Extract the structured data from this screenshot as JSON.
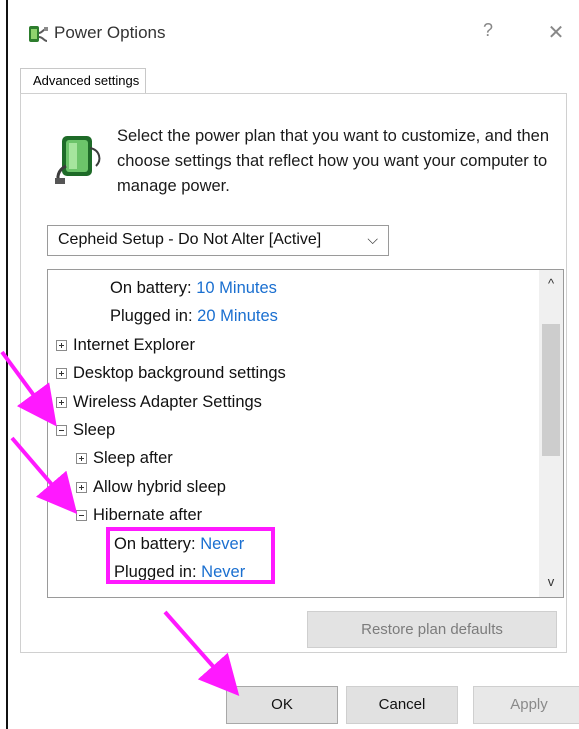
{
  "window": {
    "title": "Power Options",
    "help_symbol": "?",
    "close_symbol": "✕",
    "title_icon": "power-plan-icon"
  },
  "tabs": [
    {
      "label": "Advanced settings",
      "active": true
    }
  ],
  "intro": {
    "icon": "battery-plug-icon",
    "text": "Select the power plan that you want to customize, and then choose settings that reflect how you want your computer to manage power."
  },
  "plan_select": {
    "value": "Cepheid Setup - Do Not Alter [Active]",
    "chevron": "⌵"
  },
  "tree": {
    "rows": [
      {
        "name": "on-battery-setting",
        "type": "setting",
        "label": "On battery:",
        "value": "10 Minutes"
      },
      {
        "name": "plugged-in-setting",
        "type": "setting",
        "label": "Plugged in:",
        "value": "20 Minutes"
      },
      {
        "name": "internet-explorer",
        "type": "node",
        "state": "plus",
        "label": "Internet Explorer"
      },
      {
        "name": "desktop-background-settings",
        "type": "node",
        "state": "plus",
        "label": "Desktop background settings"
      },
      {
        "name": "wireless-adapter-settings",
        "type": "node",
        "state": "plus",
        "label": "Wireless Adapter Settings"
      },
      {
        "name": "sleep",
        "type": "node",
        "state": "minus",
        "label": "Sleep"
      },
      {
        "name": "sleep-after",
        "type": "node",
        "state": "plus",
        "label": "Sleep after"
      },
      {
        "name": "allow-hybrid-sleep",
        "type": "node",
        "state": "plus",
        "label": "Allow hybrid sleep"
      },
      {
        "name": "hibernate-after",
        "type": "node",
        "state": "minus",
        "label": "Hibernate after"
      },
      {
        "name": "hibernate-on-battery",
        "type": "setting",
        "label": "On battery:",
        "value": "Never"
      },
      {
        "name": "hibernate-plugged-in",
        "type": "setting",
        "label": "Plugged in:",
        "value": "Never"
      }
    ],
    "scroll_up": "^",
    "scroll_down": "v"
  },
  "buttons": {
    "restore": "Restore plan defaults",
    "ok": "OK",
    "cancel": "Cancel",
    "apply": "Apply"
  },
  "annotations": {
    "arrow_color": "#ff19ff",
    "highlight_color": "#ff19ff"
  },
  "colors": {
    "accent_value": "#1a6fd0",
    "disabled_text": "#7c7c7c"
  }
}
